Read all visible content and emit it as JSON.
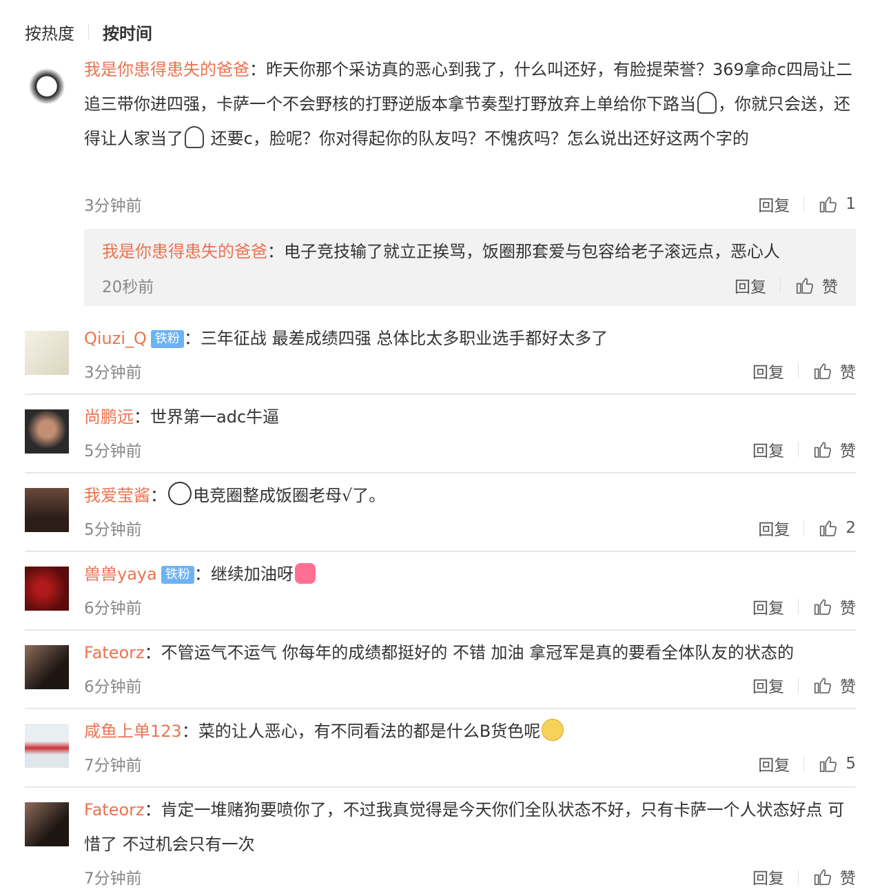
{
  "sort": {
    "hot": "按热度",
    "time": "按时间"
  },
  "actions": {
    "reply": "回复"
  },
  "comments": [
    {
      "user": "我是你患得患失的爸爸",
      "seg1": "昨天你那个采访真的恶心到我了，什么叫还好，有脸提荣誉？369拿命c四局让二追三带你进四强，卡萨一个不会野核的打野逆版本拿节奏型打野放弃上单给你下路当",
      "seg2": "，你就只会送，还得让人家当了",
      "seg3": " 还要c，脸呢？你对得起你的队友吗？不愧疚吗？怎么说出还好这两个字的",
      "time": "3分钟前",
      "likes": "1"
    },
    {
      "user": "我是你患得患失的爸爸",
      "text": "电子竞技输了就立正挨骂，饭圈那套爱与包容给老子滚远点，恶心人",
      "time": "20秒前",
      "likes": "赞"
    },
    {
      "user": "Qiuzi_Q",
      "badge": "铁粉",
      "text": "三年征战 最差成绩四强 总体比太多职业选手都好太多了",
      "time": "3分钟前",
      "likes": "赞"
    },
    {
      "user": "尚鹏远",
      "text": "世界第一adc牛逼",
      "time": "5分钟前",
      "likes": "赞"
    },
    {
      "user": "我爱莹酱",
      "text": "电竞圈整成饭圈老母√了。",
      "time": "5分钟前",
      "likes": "2"
    },
    {
      "user": "兽兽yaya",
      "badge": "铁粉",
      "text": "继续加油呀",
      "time": "6分钟前",
      "likes": "赞"
    },
    {
      "user": "Fateorz",
      "text": "不管运气不运气 你每年的成绩都挺好的 不错 加油 拿冠军是真的要看全体队友的状态的",
      "time": "6分钟前",
      "likes": "赞"
    },
    {
      "user": "咸鱼上单123",
      "text": "菜的让人恶心，有不同看法的都是什么B货色呢",
      "time": "7分钟前",
      "likes": "5"
    },
    {
      "user": "Fateorz",
      "text": "肯定一堆赌狗要喷你了，不过我真觉得是今天你们全队状态不好，只有卡萨一个人状态好点 可惜了 不过机会只有一次",
      "time": "7分钟前",
      "likes": "赞"
    }
  ],
  "colors": {
    "username": "#eb7350",
    "badge": "#6cb2f5",
    "divider": "#e6e6e6",
    "subBg": "#f2f2f2"
  }
}
